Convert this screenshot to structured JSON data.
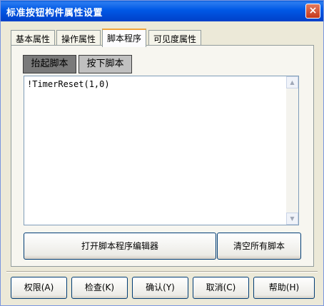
{
  "window": {
    "title": "标准按钮构件属性设置",
    "close": "×"
  },
  "tabs": [
    {
      "label": "基本属性"
    },
    {
      "label": "操作属性"
    },
    {
      "label": "脚本程序"
    },
    {
      "label": "可见度属性"
    }
  ],
  "subtabs": [
    {
      "label": "抬起脚本"
    },
    {
      "label": "按下脚本"
    }
  ],
  "editor": {
    "code": "!TimerReset(1,0)"
  },
  "actions": {
    "open_editor": "打开脚本程序编辑器",
    "clear_all": "清空所有脚本"
  },
  "bottom_buttons": [
    {
      "label": "权限(A)"
    },
    {
      "label": "检查(K)"
    },
    {
      "label": "确认(Y)"
    },
    {
      "label": "取消(C)"
    },
    {
      "label": "帮助(H)"
    }
  ]
}
